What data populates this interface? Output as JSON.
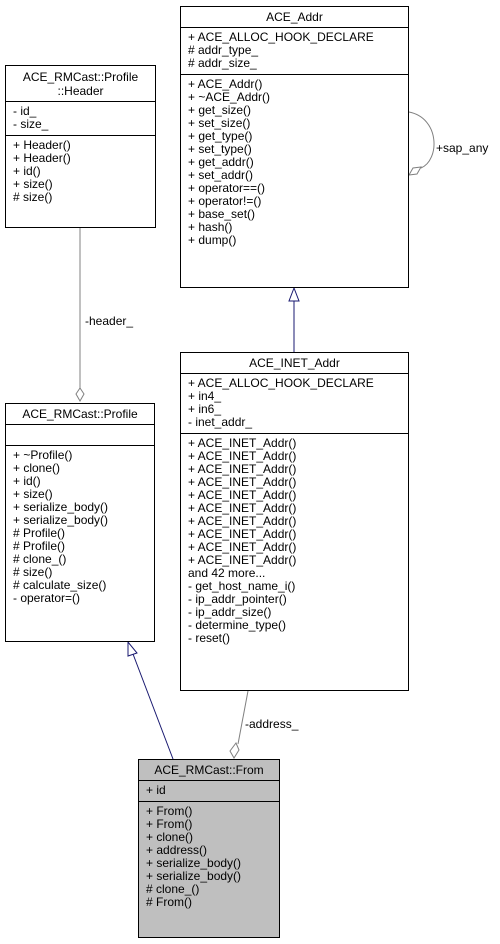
{
  "classes": {
    "ace_addr": {
      "name": "ACE_Addr",
      "attributes": [
        "+ ACE_ALLOC_HOOK_DECLARE",
        "# addr_type_",
        "# addr_size_"
      ],
      "operations": [
        "+ ACE_Addr()",
        "+ ~ACE_Addr()",
        "+ get_size()",
        "+ set_size()",
        "+ get_type()",
        "+ set_type()",
        "+ get_addr()",
        "+ set_addr()",
        "+ operator==()",
        "+ operator!=()",
        "+ base_set()",
        "+ hash()",
        "+ dump()"
      ]
    },
    "profile_header": {
      "name_line1": "ACE_RMCast::Profile",
      "name_line2": "::Header",
      "attributes": [
        "- id_",
        "- size_"
      ],
      "operations": [
        "+ Header()",
        "+ Header()",
        "+ id()",
        "+ size()",
        "# size()"
      ]
    },
    "profile": {
      "name": "ACE_RMCast::Profile",
      "attributes": [],
      "operations": [
        "+ ~Profile()",
        "+ clone()",
        "+ id()",
        "+ size()",
        "+ serialize_body()",
        "+ serialize_body()",
        "# Profile()",
        "# Profile()",
        "# clone_()",
        "# size()",
        "# calculate_size()",
        "- operator=()"
      ]
    },
    "inet_addr": {
      "name": "ACE_INET_Addr",
      "attributes": [
        "+ ACE_ALLOC_HOOK_DECLARE",
        "+ in4_",
        "+ in6_",
        "- inet_addr_"
      ],
      "operations": [
        "+ ACE_INET_Addr()",
        "+ ACE_INET_Addr()",
        "+ ACE_INET_Addr()",
        "+ ACE_INET_Addr()",
        "+ ACE_INET_Addr()",
        "+ ACE_INET_Addr()",
        "+ ACE_INET_Addr()",
        "+ ACE_INET_Addr()",
        "+ ACE_INET_Addr()",
        "+ ACE_INET_Addr()",
        "and 42 more...",
        "- get_host_name_i()",
        "- ip_addr_pointer()",
        "- ip_addr_size()",
        "- determine_type()",
        "- reset()"
      ]
    },
    "from": {
      "name": "ACE_RMCast::From",
      "attributes": [
        "+ id"
      ],
      "operations": [
        "+ From()",
        "+ From()",
        "+ clone()",
        "+ address()",
        "+ serialize_body()",
        "+ serialize_body()",
        "# clone_()",
        "# From()"
      ]
    }
  },
  "edges": {
    "sap_any_label": "+sap_any",
    "header_label": "-header_",
    "address_label": "-address_"
  },
  "colors": {
    "inheritance": "#191970",
    "association": "#808080",
    "current_class_fill": "#bfbfbf"
  }
}
